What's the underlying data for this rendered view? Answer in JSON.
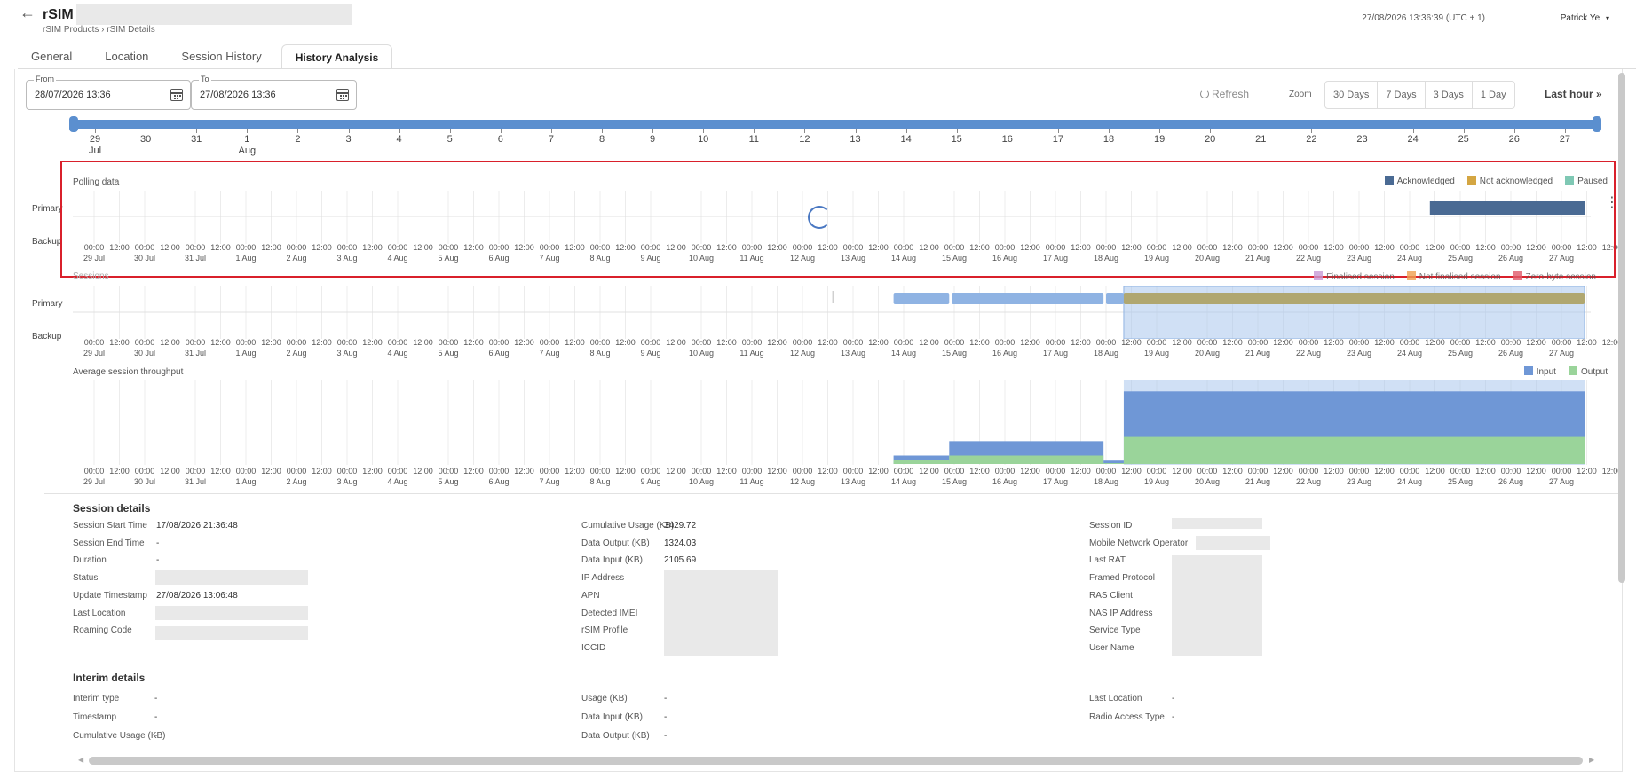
{
  "header": {
    "title": "rSIM",
    "breadcrumb": "rSIM Products › rSIM Details",
    "datetime": "27/08/2026 13:36:39 (UTC + 1)",
    "user": "Patrick Ye"
  },
  "tabs": [
    {
      "label": "General"
    },
    {
      "label": "Location"
    },
    {
      "label": "Session History"
    },
    {
      "label": "History Analysis"
    }
  ],
  "filters": {
    "from_label": "From",
    "from_value": "28/07/2026 13:36",
    "to_label": "To",
    "to_value": "27/08/2026 13:36",
    "refresh_label": "Refresh",
    "zoom_label": "Zoom",
    "zoom_options": [
      "30 Days",
      "7 Days",
      "3 Days",
      "1 Day"
    ],
    "last_hour_label": "Last hour"
  },
  "range_slider": {
    "days": [
      "29",
      "30",
      "31",
      "1",
      "2",
      "3",
      "4",
      "5",
      "6",
      "7",
      "8",
      "9",
      "10",
      "11",
      "12",
      "13",
      "14",
      "15",
      "16",
      "17",
      "18",
      "19",
      "20",
      "21",
      "22",
      "23",
      "24",
      "25",
      "26",
      "27"
    ],
    "month_labels": {
      "0": "Jul",
      "3": "Aug"
    }
  },
  "axis": {
    "dates": [
      "29 Jul",
      "30 Jul",
      "31 Jul",
      "1 Aug",
      "2 Aug",
      "3 Aug",
      "4 Aug",
      "5 Aug",
      "6 Aug",
      "7 Aug",
      "8 Aug",
      "9 Aug",
      "10 Aug",
      "11 Aug",
      "12 Aug",
      "13 Aug",
      "14 Aug",
      "15 Aug",
      "16 Aug",
      "17 Aug",
      "18 Aug",
      "19 Aug",
      "20 Aug",
      "21 Aug",
      "22 Aug",
      "23 Aug",
      "24 Aug",
      "25 Aug",
      "26 Aug",
      "27 Aug"
    ],
    "times": [
      "00:00",
      "12:00"
    ],
    "end_time": "12:00"
  },
  "polling_chart": {
    "title": "Polling data",
    "rows": [
      "Primary",
      "Backup"
    ],
    "legend": [
      {
        "label": "Acknowledged",
        "color": "#4a6a93"
      },
      {
        "label": "Not acknowledged",
        "color": "#d4a642"
      },
      {
        "label": "Paused",
        "color": "#7fc8b4"
      }
    ],
    "acknowledged_start_day": 26.4,
    "acknowledged_end_day": 30.5
  },
  "sessions_chart": {
    "title": "Sessions",
    "rows": [
      "Primary",
      "Backup"
    ],
    "legend": [
      {
        "label": "Finalised session",
        "color": "#c89ad6"
      },
      {
        "label": "Not finalised session",
        "color": "#f0a050"
      },
      {
        "label": "Zero-byte session",
        "color": "#e05a6a"
      }
    ],
    "bars": [
      {
        "start_day": 15.8,
        "end_day": 16.9,
        "color": "#8fb3e3"
      },
      {
        "start_day": 16.95,
        "end_day": 19.95,
        "color": "#8fb3e3"
      },
      {
        "start_day": 20.0,
        "end_day": 20.35,
        "color": "#8fb3e3"
      },
      {
        "start_day": 20.35,
        "end_day": 30.5,
        "color": "#b0a770"
      }
    ],
    "selection_start_day": 20.35,
    "selection_end_day": 30.5
  },
  "throughput_chart": {
    "title": "Average session throughput",
    "legend": [
      {
        "label": "Input",
        "color": "#6f97d6"
      },
      {
        "label": "Output",
        "color": "#9ad49a"
      }
    ],
    "input_steps": [
      {
        "start_day": 15.8,
        "end_day": 16.9,
        "level": 0.1
      },
      {
        "start_day": 16.9,
        "end_day": 19.95,
        "level": 0.27
      },
      {
        "start_day": 19.95,
        "end_day": 20.35,
        "level": 0.04
      },
      {
        "start_day": 20.35,
        "end_day": 30.5,
        "level": 0.86
      }
    ],
    "output_steps": [
      {
        "start_day": 15.8,
        "end_day": 16.9,
        "level": 0.05
      },
      {
        "start_day": 16.9,
        "end_day": 19.95,
        "level": 0.1
      },
      {
        "start_day": 19.95,
        "end_day": 20.35,
        "level": 0.01
      },
      {
        "start_day": 20.35,
        "end_day": 30.5,
        "level": 0.32
      }
    ],
    "selection_start_day": 20.35,
    "selection_end_day": 30.5
  },
  "session_details": {
    "title": "Session details",
    "col1": [
      {
        "label": "Session Start Time",
        "value": "17/08/2026 21:36:48"
      },
      {
        "label": "Session End Time",
        "value": "-"
      },
      {
        "label": "Duration",
        "value": "-"
      },
      {
        "label": "Status",
        "value": ""
      },
      {
        "label": "Update Timestamp",
        "value": "27/08/2026 13:06:48"
      },
      {
        "label": "Last Location",
        "value": ""
      },
      {
        "label": "Roaming Code",
        "value": ""
      }
    ],
    "col2": [
      {
        "label": "Cumulative Usage (KB)",
        "value": "3429.72"
      },
      {
        "label": "Data Output (KB)",
        "value": "1324.03"
      },
      {
        "label": "Data Input (KB)",
        "value": "2105.69"
      },
      {
        "label": "IP Address",
        "value": ""
      },
      {
        "label": "APN",
        "value": ""
      },
      {
        "label": "Detected IMEI",
        "value": ""
      },
      {
        "label": "rSIM Profile",
        "value": ""
      },
      {
        "label": "ICCID",
        "value": ""
      }
    ],
    "col3": [
      {
        "label": "Session ID",
        "value": ""
      },
      {
        "label": "Mobile Network Operator",
        "value": ""
      },
      {
        "label": "Last RAT",
        "value": ""
      },
      {
        "label": "Framed Protocol",
        "value": ""
      },
      {
        "label": "RAS Client",
        "value": ""
      },
      {
        "label": "NAS IP Address",
        "value": ""
      },
      {
        "label": "Service Type",
        "value": ""
      },
      {
        "label": "User Name",
        "value": ""
      }
    ]
  },
  "interim_details": {
    "title": "Interim details",
    "col1": [
      {
        "label": "Interim type",
        "value": "-"
      },
      {
        "label": "Timestamp",
        "value": "-"
      },
      {
        "label": "Cumulative Usage (KB)",
        "value": "-"
      }
    ],
    "col2": [
      {
        "label": "Usage (KB)",
        "value": "-"
      },
      {
        "label": "Data Input (KB)",
        "value": "-"
      },
      {
        "label": "Data Output (KB)",
        "value": "-"
      }
    ],
    "col3": [
      {
        "label": "Last Location",
        "value": "-"
      },
      {
        "label": "Radio Access Type",
        "value": "-"
      }
    ]
  }
}
